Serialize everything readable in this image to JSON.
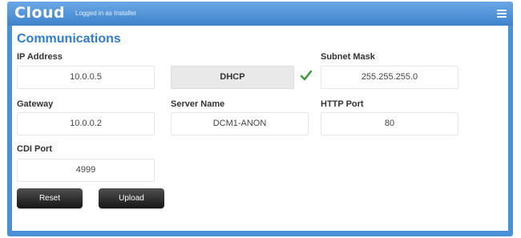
{
  "header": {
    "logo": "Cloud",
    "login_status": "Logged in as Installer",
    "menu_icon": "hamburger-menu-icon"
  },
  "page": {
    "title": "Communications"
  },
  "fields": {
    "ip_address": {
      "label": "IP Address",
      "value": "10.0.0.5"
    },
    "subnet_mask": {
      "label": "Subnet Mask",
      "value": "255.255.255.0"
    },
    "gateway": {
      "label": "Gateway",
      "value": "10.0.0.2"
    },
    "server_name": {
      "label": "Server Name",
      "value": "DCM1-ANON"
    },
    "http_port": {
      "label": "HTTP Port",
      "value": "80"
    },
    "cdi_port": {
      "label": "CDI Port",
      "value": "4999"
    }
  },
  "dhcp": {
    "label": "DHCP",
    "status_icon": "checkmark-icon",
    "status_color": "#3a9a3a"
  },
  "buttons": {
    "reset": "Reset",
    "upload": "Upload"
  },
  "colors": {
    "accent": "#4a90d9",
    "title": "#2f7dd0"
  }
}
